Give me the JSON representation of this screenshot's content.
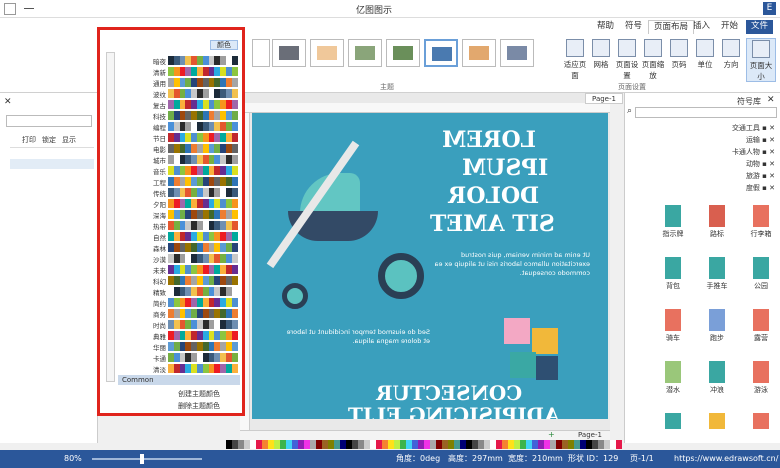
{
  "app": {
    "title": "亿图图示",
    "logo": "E"
  },
  "tabs": [
    {
      "label": "文件",
      "kind": "file"
    },
    {
      "label": "开始"
    },
    {
      "label": "插入"
    },
    {
      "label": "页面布局",
      "kind": "active"
    },
    {
      "label": "符号"
    },
    {
      "label": "帮助"
    }
  ],
  "quick": {
    "login": "登录"
  },
  "ribbon": {
    "buttons": [
      "页面大小",
      "方向",
      "单位",
      "页码",
      "页面缩放",
      "页面设置",
      "网格",
      "适应页面"
    ],
    "group_label_page": "页面设置",
    "group_label_theme": "主题",
    "theme_colors_label": "颜色",
    "theme_colors": [
      "#5b6b8a",
      "#f0a05a",
      "#8c8c8c",
      "#6a8f5a",
      "#4a7ab0",
      "#e26a6a",
      "#c49a3c"
    ]
  },
  "dropdown": {
    "labels": [
      "暗夜",
      "清新",
      "通用",
      "波纹",
      "复古",
      "科技",
      "编程",
      "节日",
      "电影",
      "城市",
      "音乐",
      "工程",
      "传统",
      "夕阳",
      "深海",
      "热带",
      "自然",
      "森林",
      "沙漠",
      "未来",
      "科幻",
      "精致",
      "简约",
      "商务",
      "时尚",
      "典雅",
      "华丽",
      "卡通",
      "清淡",
      "Common"
    ],
    "selected": "Common",
    "footer_create": "创建主题颜色",
    "footer_delete": "删除主题颜色"
  },
  "page": {
    "tab_label": "Page-1",
    "lorem": [
      "LOREM",
      "IPSUM",
      "DOLOR",
      "SIT AMET"
    ],
    "body1": "Ut enim ad minim veniam, quis nostrud exercitation ullamco laboris nisi ut aliquip ex ea commodo consequat.",
    "body2": "Sed do eiusmod tempor incididunt ut labore et dolore magna aliqua.",
    "bottom": [
      "CONSECTUR",
      "ADIPISICING ELIT"
    ]
  },
  "right_panel": {
    "title": "符号库",
    "categories": [
      "交通工具",
      "运输",
      "卡通人物",
      "动物",
      "旅游",
      "度假"
    ],
    "shapes": [
      "行李箱",
      "路标",
      "指示牌",
      "公园",
      "手推车",
      "背包",
      "露营",
      "跑步",
      "骑车",
      "游泳",
      "冲浪",
      "潜水",
      "滑雪",
      "攀岩",
      "徒步",
      "摄影",
      "野餐",
      "钓鱼"
    ]
  },
  "left_panel": {
    "cols": [
      "打印",
      "锁定",
      "显示"
    ]
  },
  "status": {
    "url": "https://www.edrawsoft.cn/",
    "page": "页-1/1",
    "shape_id": "形状 ID：129",
    "width": "宽度：210mm",
    "height": "高度：297mm",
    "angle": "角度：0deg",
    "zoom": "80%"
  },
  "page_tab": {
    "label": "Page-1"
  }
}
